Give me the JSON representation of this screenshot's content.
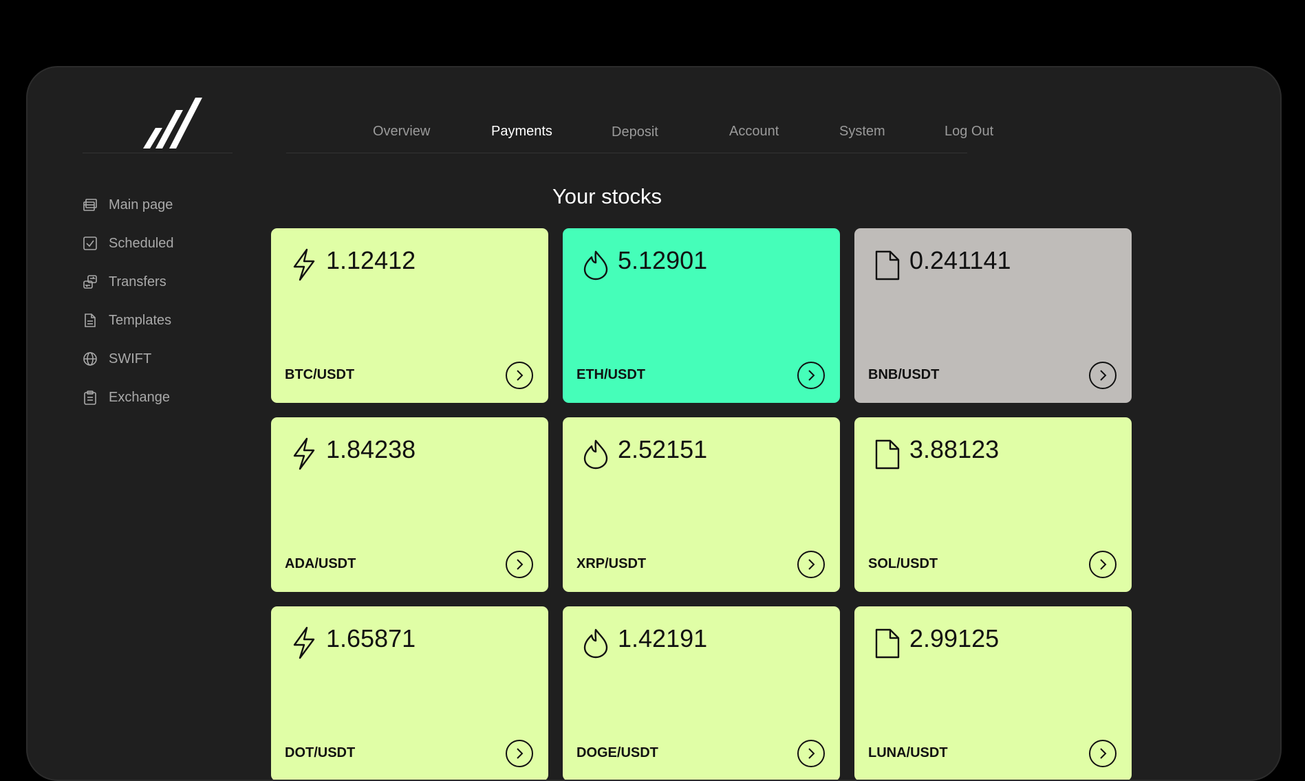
{
  "colors": {
    "page_background": "#000000",
    "frame_background": "#1f1f1f",
    "card_lime": "#e0fea6",
    "card_mint": "#45feb9",
    "card_gray": "#bfbcb9"
  },
  "logo": {
    "icon": "slashes-logo-icon"
  },
  "top_nav": {
    "items": [
      {
        "label": "Overview",
        "active": false
      },
      {
        "label": "Payments",
        "active": true
      },
      {
        "label": "Deposit",
        "active": false
      },
      {
        "label": "Account",
        "active": false
      },
      {
        "label": "System",
        "active": false
      },
      {
        "label": "Log Out",
        "active": false
      }
    ]
  },
  "sidebar": {
    "items": [
      {
        "label": "Main page",
        "icon": "browser-window-icon"
      },
      {
        "label": "Scheduled",
        "icon": "checkbox-icon"
      },
      {
        "label": "Transfers",
        "icon": "transfer-arrows-icon"
      },
      {
        "label": "Templates",
        "icon": "document-lines-icon"
      },
      {
        "label": "SWIFT",
        "icon": "globe-icon"
      },
      {
        "label": "Exchange",
        "icon": "clipboard-icon"
      }
    ]
  },
  "main": {
    "title": "Your stocks",
    "cards": [
      {
        "value": "1.12412",
        "pair": "BTC/USDT",
        "icon": "lightning-icon",
        "color": "#e0fea6"
      },
      {
        "value": "5.12901",
        "pair": "ETH/USDT",
        "icon": "drop-icon",
        "color": "#45feb9"
      },
      {
        "value": "0.241141",
        "pair": "BNB/USDT",
        "icon": "file-icon",
        "color": "#bfbcb9"
      },
      {
        "value": "1.84238",
        "pair": "ADA/USDT",
        "icon": "lightning-icon",
        "color": "#e0fea6"
      },
      {
        "value": "2.52151",
        "pair": "XRP/USDT",
        "icon": "drop-icon",
        "color": "#e0fea6"
      },
      {
        "value": "3.88123",
        "pair": "SOL/USDT",
        "icon": "file-icon",
        "color": "#e0fea6"
      },
      {
        "value": "1.65871",
        "pair": "DOT/USDT",
        "icon": "lightning-icon",
        "color": "#e0fea6"
      },
      {
        "value": "1.42191",
        "pair": "DOGE/USDT",
        "icon": "drop-icon",
        "color": "#e0fea6"
      },
      {
        "value": "2.99125",
        "pair": "LUNA/USDT",
        "icon": "file-icon",
        "color": "#e0fea6"
      }
    ],
    "card_arrow_icon": "chevron-right-circle-icon"
  }
}
